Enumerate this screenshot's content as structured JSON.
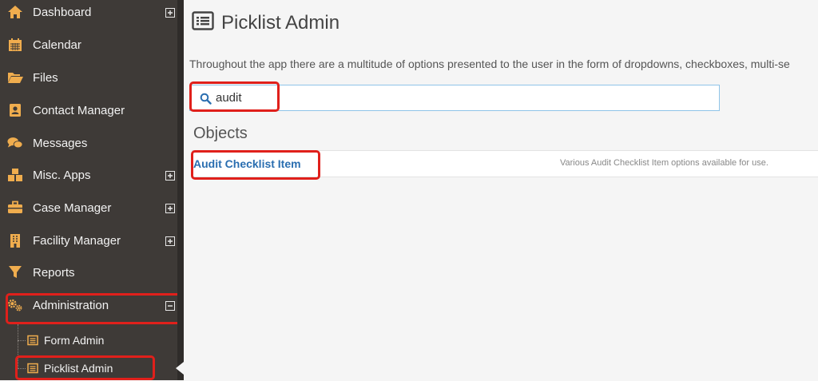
{
  "sidebar": {
    "items": [
      {
        "label": "Dashboard",
        "icon": "home-icon",
        "expandable": true
      },
      {
        "label": "Calendar",
        "icon": "calendar-icon",
        "expandable": false
      },
      {
        "label": "Files",
        "icon": "folder-open-icon",
        "expandable": false
      },
      {
        "label": "Contact Manager",
        "icon": "address-book-icon",
        "expandable": false
      },
      {
        "label": "Messages",
        "icon": "comments-icon",
        "expandable": false
      },
      {
        "label": "Misc. Apps",
        "icon": "cubes-icon",
        "expandable": true
      },
      {
        "label": "Case Manager",
        "icon": "briefcase-icon",
        "expandable": true
      },
      {
        "label": "Facility Manager",
        "icon": "building-icon",
        "expandable": true
      },
      {
        "label": "Reports",
        "icon": "filter-icon",
        "expandable": false
      },
      {
        "label": "Administration",
        "icon": "cogs-icon",
        "expandable": true,
        "expanded": true
      }
    ],
    "subitems": [
      {
        "label": "Form Admin",
        "icon": "list-alt-icon"
      },
      {
        "label": "Picklist Admin",
        "icon": "list-alt-icon",
        "active": true
      }
    ]
  },
  "main": {
    "title": "Picklist Admin",
    "title_icon": "list-alt-icon",
    "intro": "Throughout the app there are a multitude of options presented to the user in the form of dropdowns, checkboxes, multi-se",
    "search": {
      "value": "audit",
      "icon": "search-icon"
    },
    "objects_heading": "Objects",
    "objects": [
      {
        "name": "Audit Checklist Item",
        "description": "Various Audit Checklist Item options available for use."
      }
    ]
  },
  "colors": {
    "sidebar_bg": "#3e3a37",
    "icon_accent": "#f0ad4e",
    "link": "#2a6eb0",
    "highlight": "#e0201b"
  }
}
